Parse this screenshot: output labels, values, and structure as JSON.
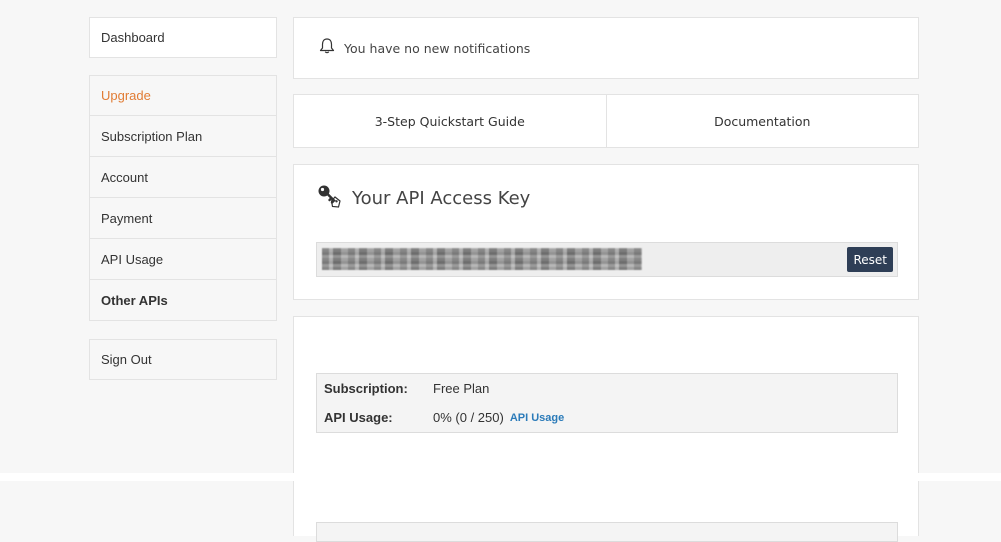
{
  "sidebar": {
    "dashboard": "Dashboard",
    "items": [
      {
        "label": "Upgrade"
      },
      {
        "label": "Subscription Plan"
      },
      {
        "label": "Account"
      },
      {
        "label": "Payment"
      },
      {
        "label": "API Usage"
      },
      {
        "label": "Other APIs"
      }
    ],
    "signout": "Sign Out"
  },
  "notification": {
    "icon": "bell-icon",
    "text": "You have no new notifications"
  },
  "tabs": [
    {
      "label": "3-Step Quickstart Guide"
    },
    {
      "label": "Documentation"
    }
  ],
  "api_key": {
    "icon": "key-icon",
    "title": "Your API Access Key",
    "reset_label": "Reset"
  },
  "subscription": {
    "subscription_label": "Subscription:",
    "subscription_value": "Free Plan",
    "usage_label": "API Usage:",
    "usage_value": "0% (0 / 250)",
    "usage_link": "API Usage"
  },
  "colors": {
    "accent_orange": "#e17c35",
    "button_navy": "#2e3e56",
    "link_blue": "#2b7bb9"
  }
}
